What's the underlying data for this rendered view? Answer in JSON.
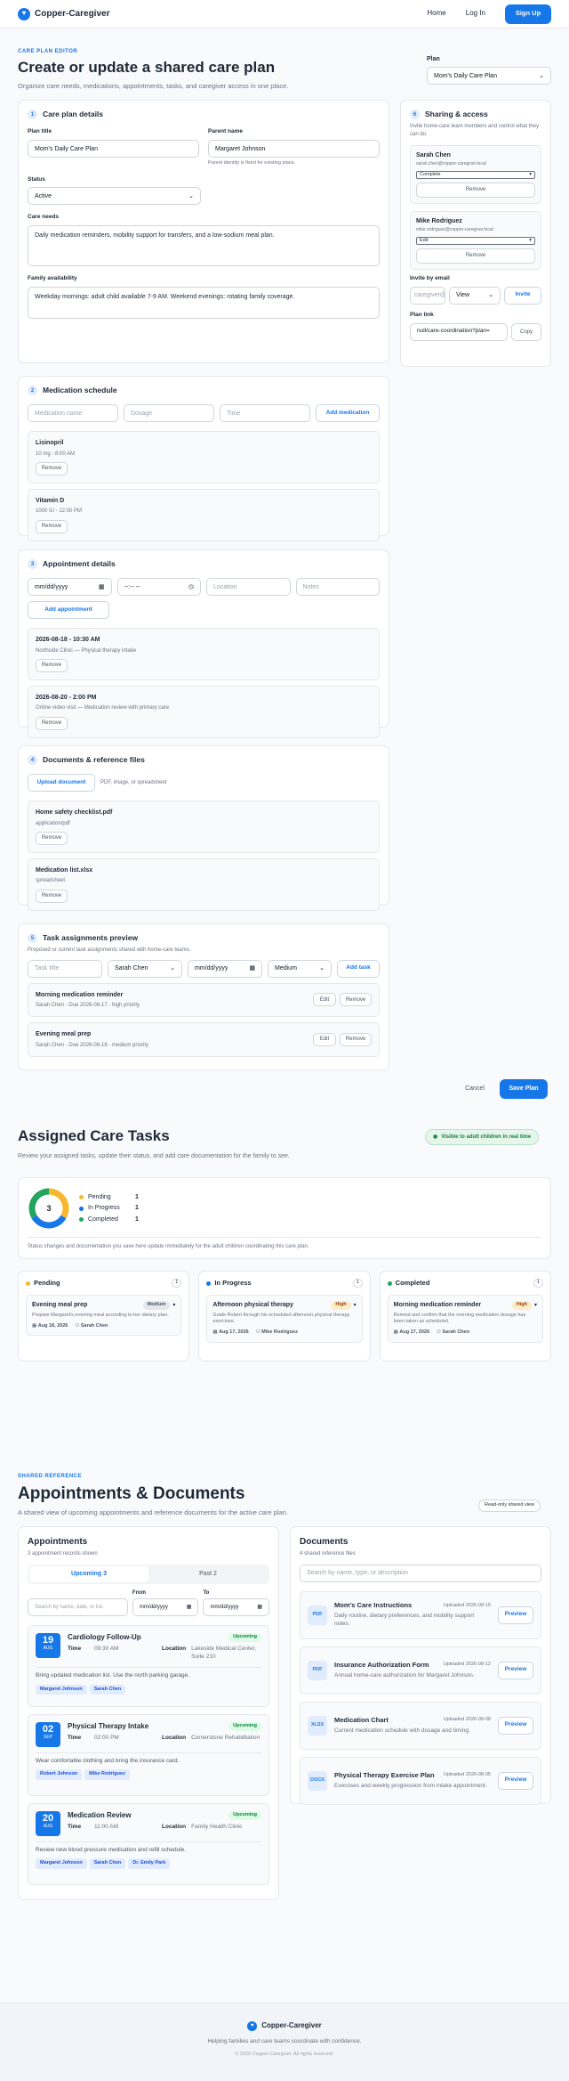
{
  "nav": {
    "brand": "Copper-Caregiver",
    "home": "Home",
    "login": "Log In",
    "signup": "Sign Up"
  },
  "editor": {
    "eyebrow": "CARE PLAN EDITOR",
    "title": "Create or update a shared care plan",
    "subtitle": "Organize care needs, medications, appointments, tasks, and caregiver access in one place.",
    "plan_label": "Plan",
    "plan_value": "Mom's Daily Care Plan"
  },
  "details": {
    "num": "1",
    "title": "Care plan details",
    "plan_title_label": "Plan title",
    "plan_title_value": "Mom's Daily Care Plan",
    "parent_label": "Parent name",
    "parent_value": "Margaret Johnson",
    "parent_help": "Parent identity is fixed for existing plans.",
    "status_label": "Status",
    "status_value": "Active",
    "needs_label": "Care needs",
    "needs_value": "Daily medication reminders, mobility support for transfers, and a low-sodium meal plan.",
    "family_label": "Family availability",
    "family_value": "Weekday mornings: adult child available 7-9 AM. Weekend evenings: rotating family coverage."
  },
  "sharing": {
    "num": "6",
    "title": "Sharing & access",
    "desc": "Invite home-care team members and control what they can do.",
    "members": [
      {
        "name": "Sarah Chen",
        "email": "sarah.chen@copper-caregiver.local",
        "role": "Complete",
        "remove": "Remove"
      },
      {
        "name": "Mike Rodriguez",
        "email": "mike.rodriguez@copper-caregiver.local",
        "role": "Edit",
        "remove": "Remove"
      }
    ],
    "invite_label": "Invite by email",
    "invite_placeholder": "caregiver@example.com",
    "invite_role": "View",
    "invite_btn": "Invite",
    "link_label": "Plan link",
    "link_value": "null/care-coordination?plan=",
    "copy": "Copy"
  },
  "meds": {
    "num": "2",
    "title": "Medication schedule",
    "name_ph": "Medication name",
    "dose_ph": "Dosage",
    "time_ph": "Time",
    "add": "Add medication",
    "items": [
      {
        "name": "Lisinopril",
        "detail": "10 mg - 8:00 AM",
        "remove": "Remove"
      },
      {
        "name": "Vitamin D",
        "detail": "1000 IU - 12:00 PM",
        "remove": "Remove"
      }
    ]
  },
  "appts": {
    "num": "3",
    "title": "Appointment details",
    "date_ph": "mm/dd/yyyy",
    "time_ph": "--:-- --",
    "loc_ph": "Location",
    "notes_ph": "Notes",
    "add": "Add appointment",
    "items": [
      {
        "when": "2026-08-18 - 10:30 AM",
        "detail": "Northside Clinic — Physical therapy intake",
        "remove": "Remove"
      },
      {
        "when": "2026-08-20 - 2:00 PM",
        "detail": "Online video visit — Medication review with primary care",
        "remove": "Remove"
      }
    ]
  },
  "docs": {
    "num": "4",
    "title": "Documents & reference files",
    "upload": "Upload document",
    "hint": "PDF, image, or spreadsheet",
    "items": [
      {
        "name": "Home safety checklist.pdf",
        "type": "application/pdf",
        "remove": "Remove"
      },
      {
        "name": "Medication list.xlsx",
        "type": "spreadsheet",
        "remove": "Remove"
      }
    ]
  },
  "tasks": {
    "num": "5",
    "title": "Task assignments preview",
    "desc": "Proposed or current task assignments shared with home-care teams.",
    "title_ph": "Task title",
    "assignee": "Sarah Chen",
    "date_ph": "mm/dd/yyyy",
    "priority": "Medium",
    "add": "Add task",
    "items": [
      {
        "name": "Morning medication reminder",
        "detail": "Sarah Chen - Due 2026-08-17 - high priority",
        "edit": "Edit",
        "remove": "Remove"
      },
      {
        "name": "Evening meal prep",
        "detail": "Sarah Chen - Due 2026-08-18 - medium priority",
        "edit": "Edit",
        "remove": "Remove"
      }
    ]
  },
  "actions": {
    "cancel": "Cancel",
    "save": "Save Plan"
  },
  "assigned": {
    "title": "Assigned Care Tasks",
    "subtitle": "Review your assigned tasks, update their status, and add care documentation for the family to see.",
    "badge": "Visible to adult children in real time",
    "total": "3",
    "legend": [
      {
        "label": "Pending",
        "count": "1",
        "color": "#f5b82e"
      },
      {
        "label": "In Progress",
        "count": "1",
        "color": "#1677e8"
      },
      {
        "label": "Completed",
        "count": "1",
        "color": "#22a45d"
      }
    ],
    "note": "Status changes and documentation you save here update immediately for the adult children coordinating this care plan.",
    "columns": [
      {
        "title": "Pending",
        "count": "1",
        "color": "#f5b82e",
        "task": "Evening meal prep",
        "priority": "Medium",
        "priority_bg": "#e5e7eb",
        "priority_fg": "#4b5563",
        "desc": "Prepare Margaret's evening meal according to her dietary plan.",
        "date": "Aug 18, 2026",
        "person": "Sarah Chen"
      },
      {
        "title": "In Progress",
        "count": "1",
        "color": "#1677e8",
        "task": "Afternoon physical therapy",
        "priority": "High",
        "priority_bg": "#fdecc8",
        "priority_fg": "#92400e",
        "desc": "Guide Robert through his scheduled afternoon physical therapy exercises.",
        "date": "Aug 17, 2026",
        "person": "Mike Rodriguez"
      },
      {
        "title": "Completed",
        "count": "1",
        "color": "#22a45d",
        "task": "Morning medication reminder",
        "priority": "High",
        "priority_bg": "#fdecc8",
        "priority_fg": "#92400e",
        "desc": "Remind and confirm that the morning medication dosage has been taken as scheduled.",
        "date": "Aug 17, 2026",
        "person": "Sarah Chen"
      }
    ]
  },
  "shared": {
    "eyebrow": "SHARED REFERENCE",
    "title": "Appointments & Documents",
    "subtitle": "A shared view of upcoming appointments and reference documents for the active care plan.",
    "badge": "Read-only shared view"
  },
  "appt_panel": {
    "title": "Appointments",
    "count": "3 appointment records shown",
    "tab_upcoming": "Upcoming 3",
    "tab_past": "Past 2",
    "from": "From",
    "to": "To",
    "search_ph": "Search by name, date, or loc",
    "date_ph": "mm/dd/yyyy",
    "items": [
      {
        "day": "19",
        "month": "AUG",
        "title": "Cardiology Follow-Up",
        "status": "Upcoming",
        "time": "09:30 AM",
        "location": "Lakeside Medical Center, Suite 210",
        "note": "Bring updated medication list. Use the north parking garage.",
        "people": [
          "Margaret Johnson",
          "Sarah Chen"
        ]
      },
      {
        "day": "02",
        "month": "SEP",
        "title": "Physical Therapy Intake",
        "status": "Upcoming",
        "time": "02:00 PM",
        "location": "Cornerstone Rehabilitation",
        "note": "Wear comfortable clothing and bring the insurance card.",
        "people": [
          "Robert Johnson",
          "Mike Rodriguez"
        ]
      },
      {
        "day": "20",
        "month": "AUG",
        "title": "Medication Review",
        "status": "Upcoming",
        "time": "11:00 AM",
        "location": "Family Health Clinic",
        "note": "Review new blood pressure medication and refill schedule.",
        "people": [
          "Margaret Johnson",
          "Sarah Chen",
          "Dr. Emily Park"
        ]
      }
    ],
    "time_label": "Time",
    "loc_label": "Location"
  },
  "doc_panel": {
    "title": "Documents",
    "count": "4 shared reference files",
    "search_ph": "Search by name, type, or description",
    "items": [
      {
        "type": "PDF",
        "name": "Mom's Care Instructions",
        "uploaded": "Uploaded 2026-08-15",
        "desc": "Daily routine, dietary preferences, and mobility support notes.",
        "btn": "Preview"
      },
      {
        "type": "PDF",
        "name": "Insurance Authorization Form",
        "uploaded": "Uploaded 2026-08-12",
        "desc": "Annual home-care authorization for Margaret Johnson.",
        "btn": "Preview"
      },
      {
        "type": "XLSX",
        "name": "Medication Chart",
        "uploaded": "Uploaded 2026-08-08",
        "desc": "Current medication schedule with dosage and timing.",
        "btn": "Preview"
      },
      {
        "type": "DOCX",
        "name": "Physical Therapy Exercise Plan",
        "uploaded": "Uploaded 2026-08-05",
        "desc": "Exercises and weekly progression from intake appointment.",
        "btn": "Preview"
      }
    ]
  },
  "footer": {
    "brand": "Copper-Caregiver",
    "tagline": "Helping families and care teams coordinate with confidence.",
    "copy": "© 2026 Copper-Caregiver. All rights reserved."
  }
}
